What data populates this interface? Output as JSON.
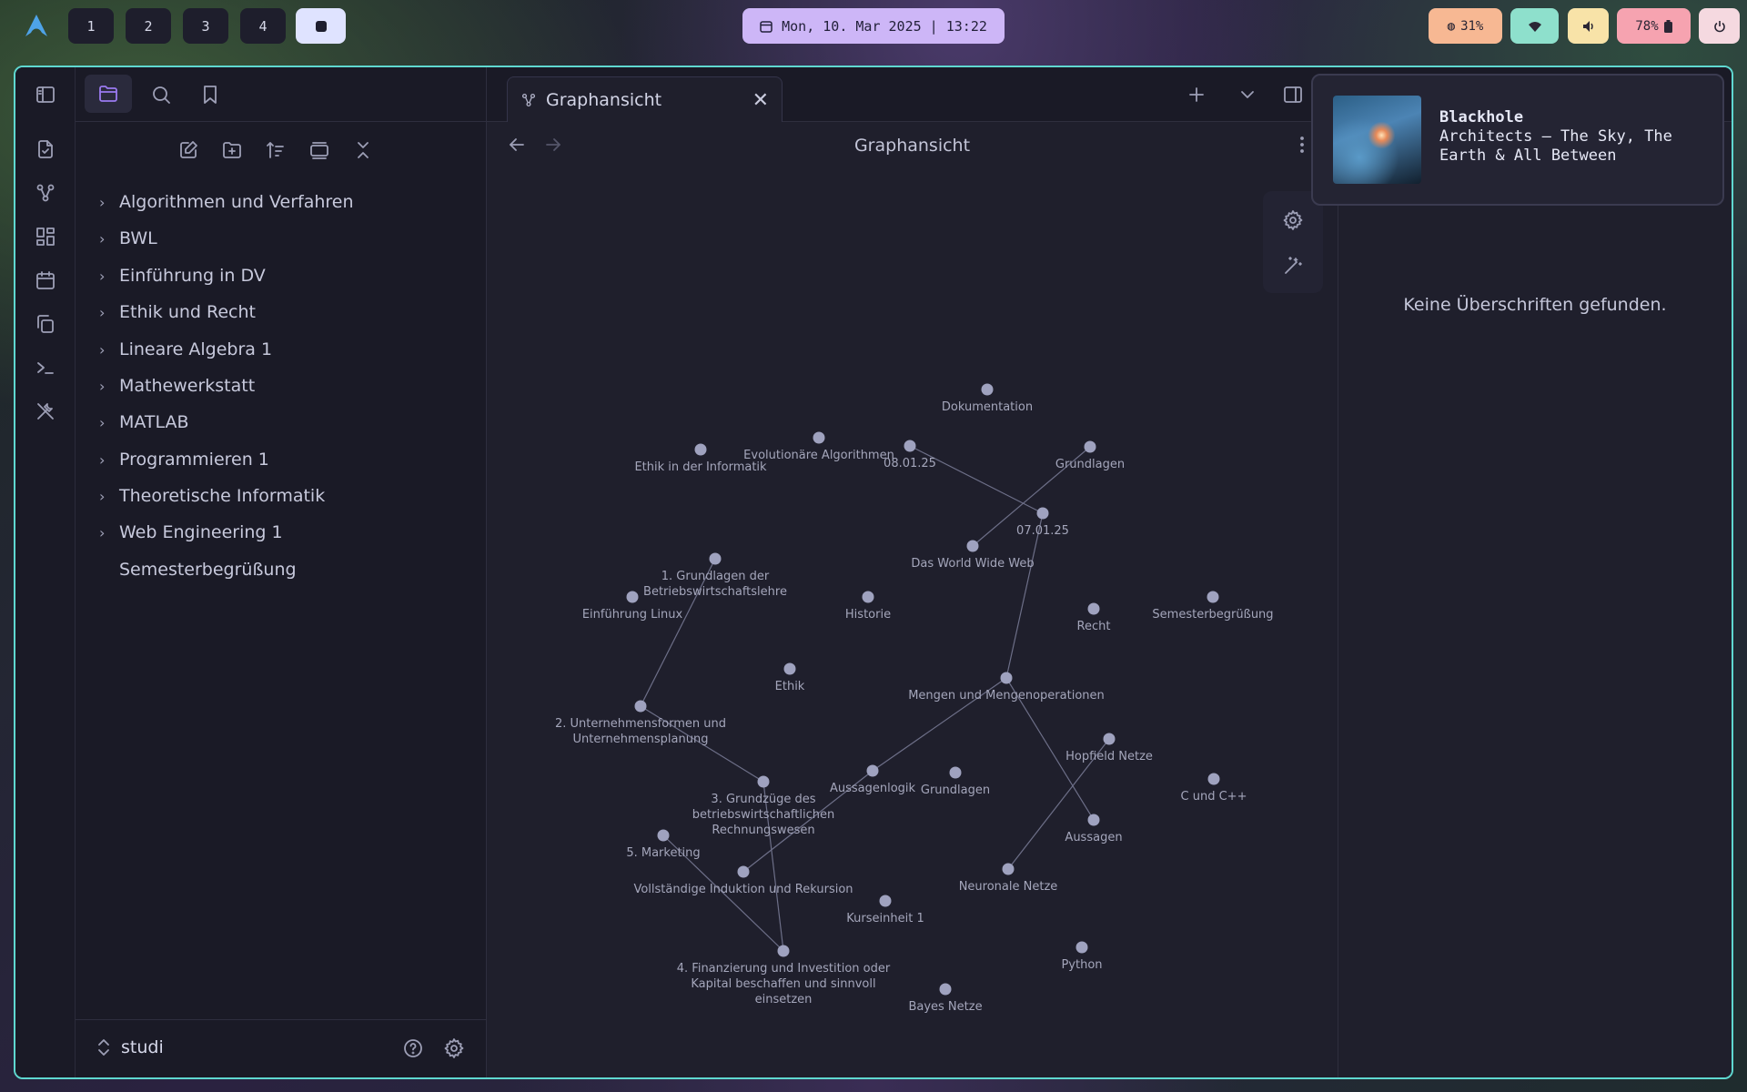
{
  "topbar": {
    "workspaces": [
      "1",
      "2",
      "3",
      "4",
      ""
    ],
    "clock": "Mon, 10. Mar 2025 | 13:22",
    "cpu": "31%",
    "battery": "78%",
    "colors": {
      "clock": "#cdb6f7",
      "cpu": "#f7b893",
      "wifi": "#8ee0cc",
      "volume": "#f8e3a8",
      "battery": "#f6a3b0",
      "power": "#f5d9e0"
    }
  },
  "tab": {
    "title": "Graphansicht",
    "icon": "graph-icon"
  },
  "graph": {
    "title": "Graphansicht"
  },
  "sidebar": {
    "folders": [
      "Algorithmen und Verfahren",
      "BWL",
      "Einführung in DV",
      "Ethik und Recht",
      "Lineare Algebra 1",
      "Mathewerkstatt",
      "MATLAB",
      "Programmieren 1",
      "Theoretische Informatik",
      "Web Engineering 1"
    ],
    "file": "Semesterbegrüßung",
    "vault": "studi"
  },
  "outline": {
    "empty": "Keine Überschriften gefunden."
  },
  "media": {
    "title": "Blackhole",
    "artist_album": "Architects – The Sky, The Earth & All Between"
  },
  "graph_nodes": [
    {
      "id": "dok",
      "label": [
        "Dokumentation"
      ]
    },
    {
      "id": "evo",
      "label": [
        "Evolutionäre Algorithmen"
      ]
    },
    {
      "id": "ethikinf",
      "label": [
        "Ethik in der Informatik"
      ]
    },
    {
      "id": "d080125",
      "label": [
        "08.01.25"
      ]
    },
    {
      "id": "grund1",
      "label": [
        "Grundlagen"
      ]
    },
    {
      "id": "d070125",
      "label": [
        "07.01.25"
      ]
    },
    {
      "id": "www",
      "label": [
        "Das World Wide Web"
      ]
    },
    {
      "id": "bwl1",
      "label": [
        "1. Grundlagen der",
        "Betriebswirtschaftslehre"
      ]
    },
    {
      "id": "linux",
      "label": [
        "Einführung Linux"
      ]
    },
    {
      "id": "historie",
      "label": [
        "Historie"
      ]
    },
    {
      "id": "recht",
      "label": [
        "Recht"
      ]
    },
    {
      "id": "semester",
      "label": [
        "Semesterbegrüßung"
      ]
    },
    {
      "id": "ethik",
      "label": [
        "Ethik"
      ]
    },
    {
      "id": "mengen",
      "label": [
        "Mengen und Mengenoperationen"
      ]
    },
    {
      "id": "bwl2",
      "label": [
        "2. Unternehmensformen und",
        "Unternehmensplanung"
      ]
    },
    {
      "id": "hopfield",
      "label": [
        "Hopfield Netze"
      ]
    },
    {
      "id": "ccpp",
      "label": [
        "C und C++"
      ]
    },
    {
      "id": "aussagenlogik",
      "label": [
        "Aussagenlogik"
      ]
    },
    {
      "id": "grund2",
      "label": [
        "Grundlagen"
      ]
    },
    {
      "id": "bwl3",
      "label": [
        "3. Grundzüge des",
        "betriebswirtschaftlichen",
        "Rechnungswesen"
      ]
    },
    {
      "id": "aussagen",
      "label": [
        "Aussagen"
      ]
    },
    {
      "id": "marketing",
      "label": [
        "5. Marketing"
      ]
    },
    {
      "id": "induktion",
      "label": [
        "Vollständige Induktion und Rekursion"
      ]
    },
    {
      "id": "neuronal",
      "label": [
        "Neuronale Netze"
      ]
    },
    {
      "id": "kurs",
      "label": [
        "Kurseinheit 1"
      ]
    },
    {
      "id": "python",
      "label": [
        "Python"
      ]
    },
    {
      "id": "bwl4",
      "label": [
        "4. Finanzierung und Investition oder",
        "Kapital beschaffen und sinnvoll",
        "einsetzen"
      ]
    },
    {
      "id": "bayes",
      "label": [
        "Bayes Netze"
      ]
    }
  ],
  "graph_edges": [
    [
      "d080125",
      "d070125"
    ],
    [
      "grund1",
      "www"
    ],
    [
      "d070125",
      "mengen"
    ],
    [
      "bwl1",
      "bwl2"
    ],
    [
      "bwl2",
      "bwl3"
    ],
    [
      "bwl3",
      "bwl4"
    ],
    [
      "marketing",
      "bwl4"
    ],
    [
      "mengen",
      "aussagenlogik"
    ],
    [
      "aussagenlogik",
      "induktion"
    ],
    [
      "mengen",
      "aussagen"
    ],
    [
      "hopfield",
      "neuronal"
    ]
  ]
}
